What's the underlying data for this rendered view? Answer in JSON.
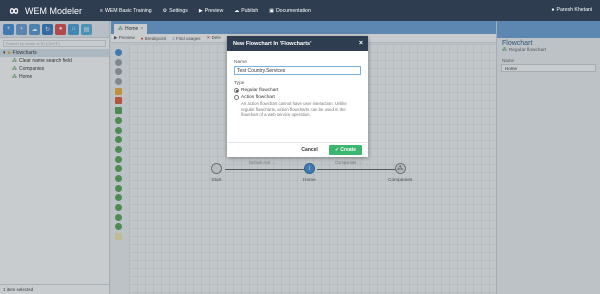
{
  "app": {
    "title": "WEM Modeler"
  },
  "topnav": {
    "items": [
      {
        "label": "WEM Basic Training",
        "icon": "menu-icon",
        "glyph": "≡"
      },
      {
        "label": "Settings",
        "icon": "gear-icon",
        "glyph": "⚙"
      },
      {
        "label": "Preview",
        "icon": "play-icon",
        "glyph": "▶"
      },
      {
        "label": "Publish",
        "icon": "cloud-upload-icon",
        "glyph": "☁"
      },
      {
        "label": "Documentation",
        "icon": "book-icon",
        "glyph": "▣"
      }
    ],
    "user": "Paresh Khetani"
  },
  "left": {
    "search_placeholder": "Search by name or ID (Ctrl+F)",
    "tree": {
      "root": "Flowcharts",
      "children": [
        "Clear name search field",
        "Companies",
        "Home"
      ]
    },
    "status": "1 item selected"
  },
  "editor": {
    "tab": "Home",
    "toolbar": [
      "Preview",
      "Breakpoint",
      "Find usages",
      "Dele"
    ]
  },
  "flow": {
    "nodes": [
      "Start",
      "Home",
      "Companies"
    ],
    "edges": [
      "Default exit →",
      "Companies →"
    ]
  },
  "right": {
    "title": "Flowchart",
    "subtitle": "Regular flowchart",
    "name_label": "Name",
    "name_value": "Home"
  },
  "dialog": {
    "title": "New Flowchart In 'Flowcharts'",
    "name_label": "Name",
    "name_value": "Test Country.Services",
    "type_label": "Type",
    "options": [
      "Regular flowchart",
      "Action flowchart"
    ],
    "action_desc": "An action flowchart cannot have user interaction. Unlike regular flowcharts, action flowcharts can be used in the flowchart of a web service operation.",
    "cancel": "Cancel",
    "create": "Create"
  },
  "colors": {
    "accent": "#6fa3d8",
    "topbar": "#2e3e50",
    "create": "#3bb66f"
  }
}
